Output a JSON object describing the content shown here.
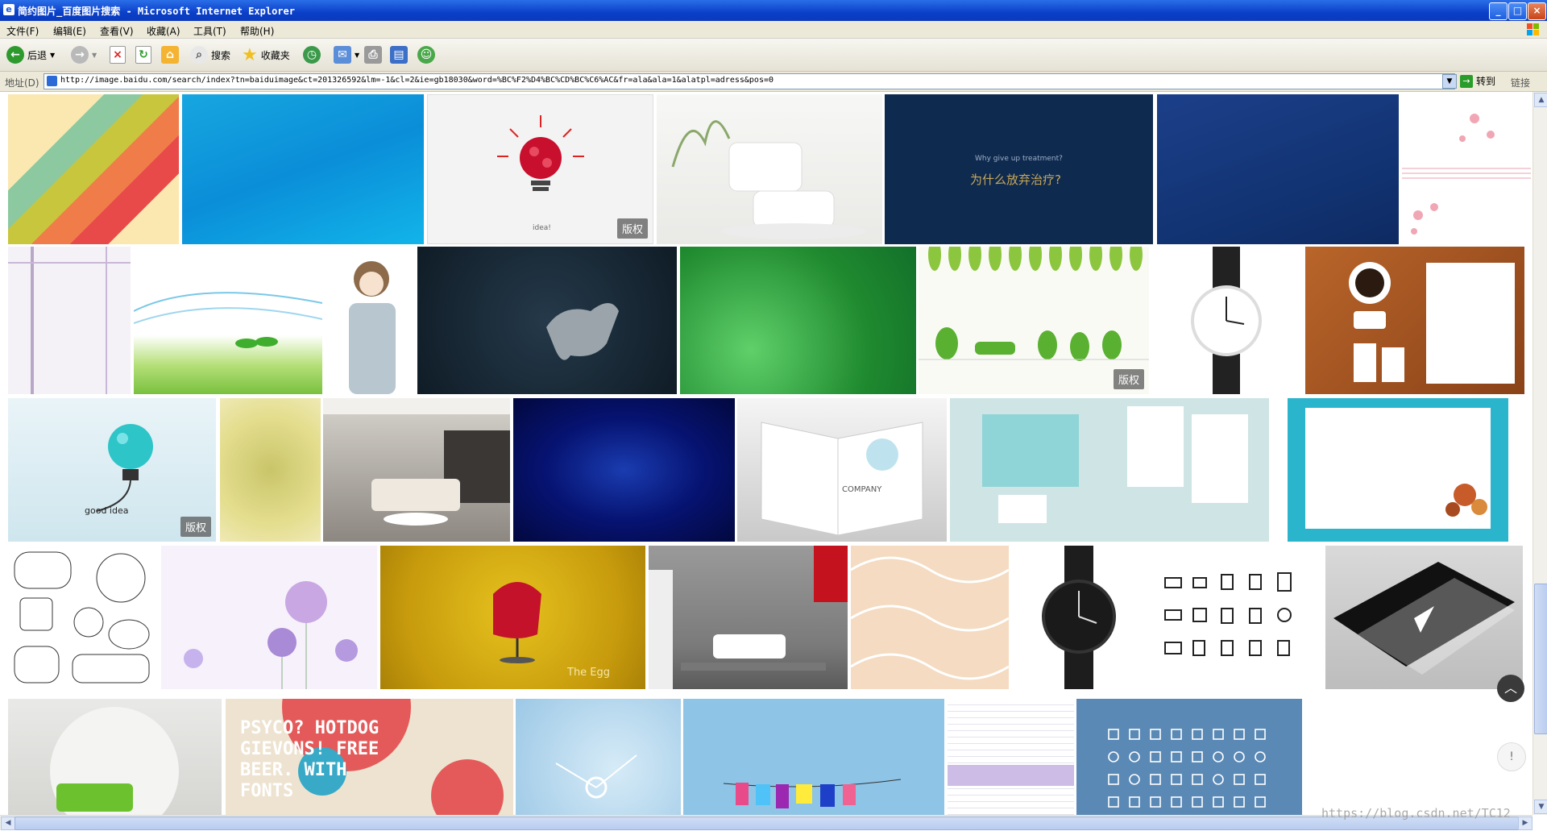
{
  "window": {
    "title": "简约图片_百度图片搜索 - Microsoft Internet Explorer",
    "minimize": "_",
    "maximize": "□",
    "close": "×"
  },
  "menu": [
    "文件(F)",
    "编辑(E)",
    "查看(V)",
    "收藏(A)",
    "工具(T)",
    "帮助(H)"
  ],
  "toolbar": {
    "back": "后退",
    "search": "搜索",
    "favorites": "收藏夹"
  },
  "address": {
    "label": "地址(D)",
    "url": "http://image.baidu.com/search/index?tn=baiduimage&ct=201326592&lm=-1&cl=2&ie=gb18030&word=%BC%F2%D4%BC%CD%BC%C6%AC&fr=ala&ala=1&alatpl=adress&pos=0",
    "go": "转到",
    "links": "链接"
  },
  "results": {
    "badge": "版权",
    "tile_texts": {
      "idea_caption": "idea!",
      "good_idea": "good idea",
      "why_text": "为什么放弃治疗?",
      "why_small": "Why give up treatment?",
      "company": "COMPANY",
      "egg": "The Egg",
      "poster": "PSYCO? HOTDOG GIEVONS! FREE BEER. WITH FONTS"
    }
  },
  "floating": {
    "top_button": "︿",
    "feedback_button": "!"
  },
  "watermark": "https://blog.csdn.net/TC12"
}
